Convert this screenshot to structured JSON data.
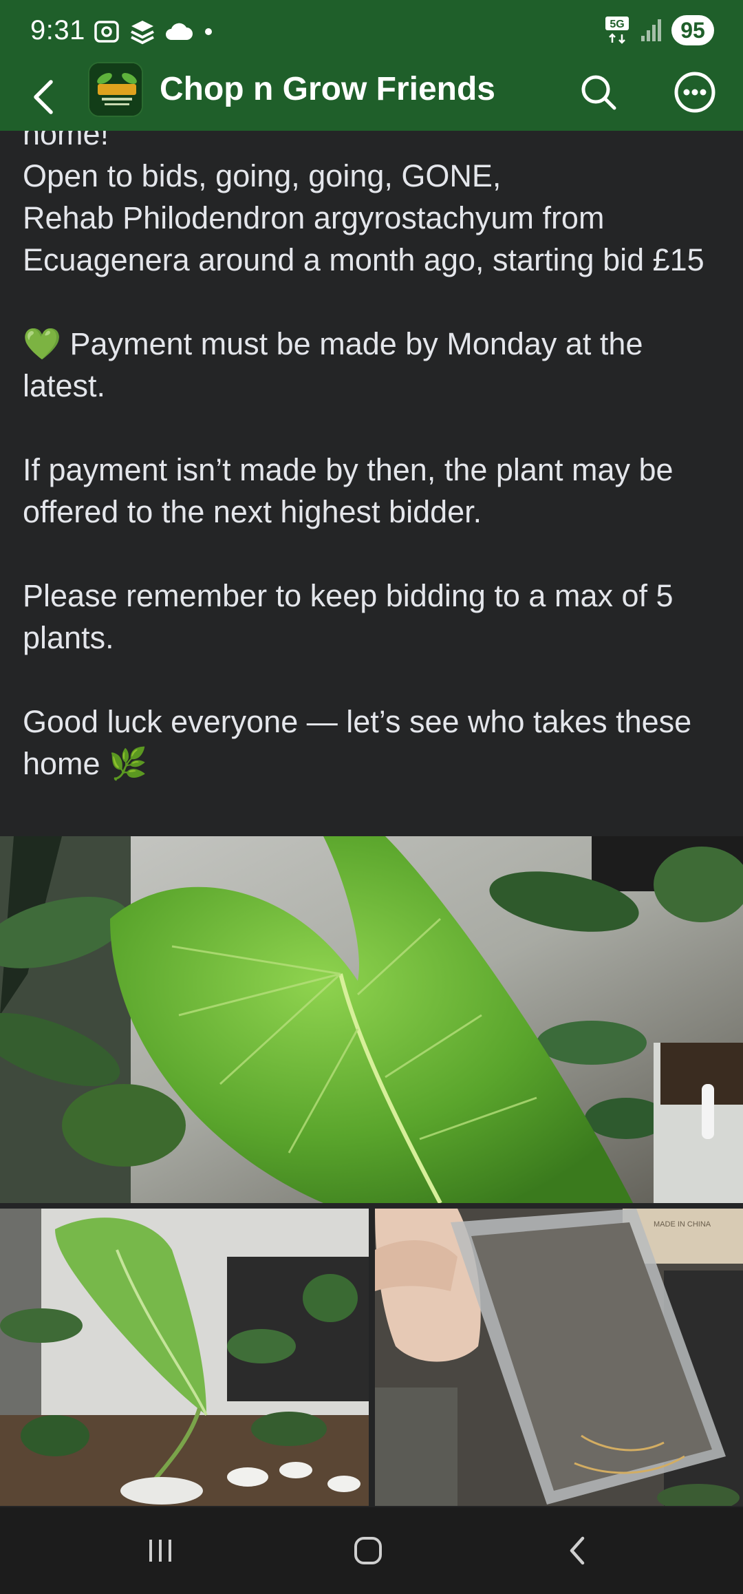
{
  "status_bar": {
    "time": "9:31",
    "network": "5G",
    "battery": "95",
    "icons": [
      "screenshot-icon",
      "stack-icon",
      "cloud-icon",
      "dot-icon",
      "signal-icon"
    ]
  },
  "header": {
    "title": "Chop n Grow Friends",
    "logo_text": "Chop N Grow Friends",
    "accent_color": "#1f5f2a"
  },
  "post": {
    "top_cutoff": "home!",
    "line1": "Open to bids, going, going, GONE,",
    "line2": "Rehab Philodendron argyrostachyum from Ecuagenera around a month ago, starting bid £15",
    "payment": "Payment must be made by Monday at the latest.",
    "payment_emoji": "💚",
    "fallback": "If payment isn’t made by then, the plant may be offered to the next highest bidder.",
    "reminder": "Please remember to keep bidding to a max of 5 plants.",
    "closing": "Good luck everyone — let’s see who takes these home",
    "closing_emoji": "🌿"
  },
  "photos": {
    "main": "Large green philodendron leaf",
    "left": "Philodendron in pot among other plants",
    "right": "Hand holding clear pot with roots",
    "pot_label": "MADE IN CHINA"
  }
}
